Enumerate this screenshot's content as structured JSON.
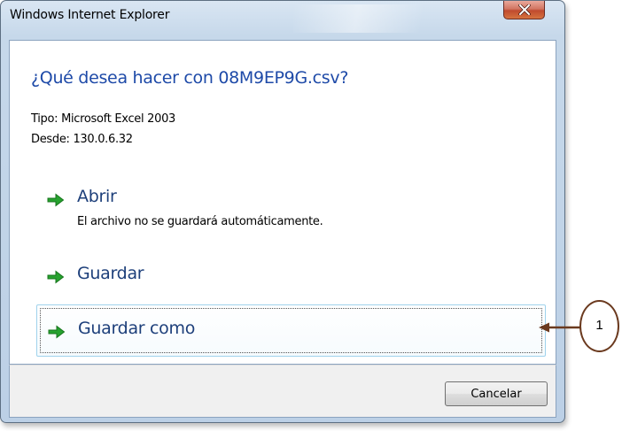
{
  "window": {
    "title": "Windows Internet Explorer"
  },
  "dialog": {
    "question": "¿Qué desea hacer con 08M9EP9G.csv?",
    "type_line": "Tipo: Microsoft Excel 2003",
    "from_line": "Desde: 130.0.6.32",
    "options": [
      {
        "label": "Abrir",
        "sublabel": "El archivo no se guardará automáticamente.",
        "icon": "green-arrow-icon"
      },
      {
        "label": "Guardar",
        "icon": "green-arrow-icon"
      },
      {
        "label": "Guardar como",
        "icon": "green-arrow-icon",
        "focused": true
      }
    ],
    "cancel_label": "Cancelar"
  },
  "callout": {
    "number": "1"
  },
  "colors": {
    "accent_text": "#1e4aa8",
    "option_text": "#1d3f7a",
    "arrow_green": "#27a22f",
    "close_red": "#c04a2e",
    "callout_brown": "#6b3a1f"
  }
}
